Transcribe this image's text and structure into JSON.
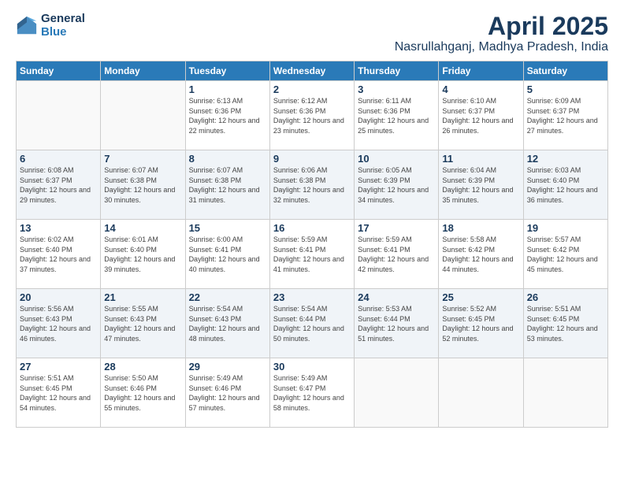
{
  "logo": {
    "general": "General",
    "blue": "Blue"
  },
  "title": "April 2025",
  "subtitle": "Nasrullahganj, Madhya Pradesh, India",
  "headers": [
    "Sunday",
    "Monday",
    "Tuesday",
    "Wednesday",
    "Thursday",
    "Friday",
    "Saturday"
  ],
  "weeks": [
    [
      {
        "day": "",
        "sunrise": "",
        "sunset": "",
        "daylight": ""
      },
      {
        "day": "",
        "sunrise": "",
        "sunset": "",
        "daylight": ""
      },
      {
        "day": "1",
        "sunrise": "Sunrise: 6:13 AM",
        "sunset": "Sunset: 6:36 PM",
        "daylight": "Daylight: 12 hours and 22 minutes."
      },
      {
        "day": "2",
        "sunrise": "Sunrise: 6:12 AM",
        "sunset": "Sunset: 6:36 PM",
        "daylight": "Daylight: 12 hours and 23 minutes."
      },
      {
        "day": "3",
        "sunrise": "Sunrise: 6:11 AM",
        "sunset": "Sunset: 6:36 PM",
        "daylight": "Daylight: 12 hours and 25 minutes."
      },
      {
        "day": "4",
        "sunrise": "Sunrise: 6:10 AM",
        "sunset": "Sunset: 6:37 PM",
        "daylight": "Daylight: 12 hours and 26 minutes."
      },
      {
        "day": "5",
        "sunrise": "Sunrise: 6:09 AM",
        "sunset": "Sunset: 6:37 PM",
        "daylight": "Daylight: 12 hours and 27 minutes."
      }
    ],
    [
      {
        "day": "6",
        "sunrise": "Sunrise: 6:08 AM",
        "sunset": "Sunset: 6:37 PM",
        "daylight": "Daylight: 12 hours and 29 minutes."
      },
      {
        "day": "7",
        "sunrise": "Sunrise: 6:07 AM",
        "sunset": "Sunset: 6:38 PM",
        "daylight": "Daylight: 12 hours and 30 minutes."
      },
      {
        "day": "8",
        "sunrise": "Sunrise: 6:07 AM",
        "sunset": "Sunset: 6:38 PM",
        "daylight": "Daylight: 12 hours and 31 minutes."
      },
      {
        "day": "9",
        "sunrise": "Sunrise: 6:06 AM",
        "sunset": "Sunset: 6:38 PM",
        "daylight": "Daylight: 12 hours and 32 minutes."
      },
      {
        "day": "10",
        "sunrise": "Sunrise: 6:05 AM",
        "sunset": "Sunset: 6:39 PM",
        "daylight": "Daylight: 12 hours and 34 minutes."
      },
      {
        "day": "11",
        "sunrise": "Sunrise: 6:04 AM",
        "sunset": "Sunset: 6:39 PM",
        "daylight": "Daylight: 12 hours and 35 minutes."
      },
      {
        "day": "12",
        "sunrise": "Sunrise: 6:03 AM",
        "sunset": "Sunset: 6:40 PM",
        "daylight": "Daylight: 12 hours and 36 minutes."
      }
    ],
    [
      {
        "day": "13",
        "sunrise": "Sunrise: 6:02 AM",
        "sunset": "Sunset: 6:40 PM",
        "daylight": "Daylight: 12 hours and 37 minutes."
      },
      {
        "day": "14",
        "sunrise": "Sunrise: 6:01 AM",
        "sunset": "Sunset: 6:40 PM",
        "daylight": "Daylight: 12 hours and 39 minutes."
      },
      {
        "day": "15",
        "sunrise": "Sunrise: 6:00 AM",
        "sunset": "Sunset: 6:41 PM",
        "daylight": "Daylight: 12 hours and 40 minutes."
      },
      {
        "day": "16",
        "sunrise": "Sunrise: 5:59 AM",
        "sunset": "Sunset: 6:41 PM",
        "daylight": "Daylight: 12 hours and 41 minutes."
      },
      {
        "day": "17",
        "sunrise": "Sunrise: 5:59 AM",
        "sunset": "Sunset: 6:41 PM",
        "daylight": "Daylight: 12 hours and 42 minutes."
      },
      {
        "day": "18",
        "sunrise": "Sunrise: 5:58 AM",
        "sunset": "Sunset: 6:42 PM",
        "daylight": "Daylight: 12 hours and 44 minutes."
      },
      {
        "day": "19",
        "sunrise": "Sunrise: 5:57 AM",
        "sunset": "Sunset: 6:42 PM",
        "daylight": "Daylight: 12 hours and 45 minutes."
      }
    ],
    [
      {
        "day": "20",
        "sunrise": "Sunrise: 5:56 AM",
        "sunset": "Sunset: 6:43 PM",
        "daylight": "Daylight: 12 hours and 46 minutes."
      },
      {
        "day": "21",
        "sunrise": "Sunrise: 5:55 AM",
        "sunset": "Sunset: 6:43 PM",
        "daylight": "Daylight: 12 hours and 47 minutes."
      },
      {
        "day": "22",
        "sunrise": "Sunrise: 5:54 AM",
        "sunset": "Sunset: 6:43 PM",
        "daylight": "Daylight: 12 hours and 48 minutes."
      },
      {
        "day": "23",
        "sunrise": "Sunrise: 5:54 AM",
        "sunset": "Sunset: 6:44 PM",
        "daylight": "Daylight: 12 hours and 50 minutes."
      },
      {
        "day": "24",
        "sunrise": "Sunrise: 5:53 AM",
        "sunset": "Sunset: 6:44 PM",
        "daylight": "Daylight: 12 hours and 51 minutes."
      },
      {
        "day": "25",
        "sunrise": "Sunrise: 5:52 AM",
        "sunset": "Sunset: 6:45 PM",
        "daylight": "Daylight: 12 hours and 52 minutes."
      },
      {
        "day": "26",
        "sunrise": "Sunrise: 5:51 AM",
        "sunset": "Sunset: 6:45 PM",
        "daylight": "Daylight: 12 hours and 53 minutes."
      }
    ],
    [
      {
        "day": "27",
        "sunrise": "Sunrise: 5:51 AM",
        "sunset": "Sunset: 6:45 PM",
        "daylight": "Daylight: 12 hours and 54 minutes."
      },
      {
        "day": "28",
        "sunrise": "Sunrise: 5:50 AM",
        "sunset": "Sunset: 6:46 PM",
        "daylight": "Daylight: 12 hours and 55 minutes."
      },
      {
        "day": "29",
        "sunrise": "Sunrise: 5:49 AM",
        "sunset": "Sunset: 6:46 PM",
        "daylight": "Daylight: 12 hours and 57 minutes."
      },
      {
        "day": "30",
        "sunrise": "Sunrise: 5:49 AM",
        "sunset": "Sunset: 6:47 PM",
        "daylight": "Daylight: 12 hours and 58 minutes."
      },
      {
        "day": "",
        "sunrise": "",
        "sunset": "",
        "daylight": ""
      },
      {
        "day": "",
        "sunrise": "",
        "sunset": "",
        "daylight": ""
      },
      {
        "day": "",
        "sunrise": "",
        "sunset": "",
        "daylight": ""
      }
    ]
  ]
}
